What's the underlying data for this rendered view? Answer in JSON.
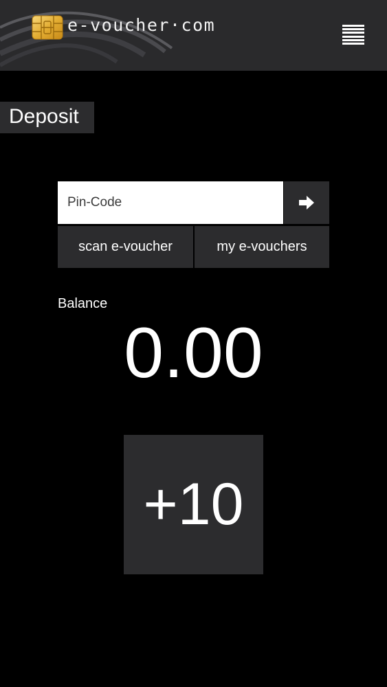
{
  "header": {
    "brand": "e-voucher·com",
    "logo_icon": "sim-chip-icon",
    "menu_icon": "hamburger-menu-icon"
  },
  "page": {
    "title": "Deposit"
  },
  "pin": {
    "placeholder": "Pin-Code",
    "value": "",
    "submit_icon": "arrow-right-icon"
  },
  "buttons": {
    "scan": "scan e-voucher",
    "my_vouchers": "my e-vouchers",
    "add_amount": "+10"
  },
  "balance": {
    "label": "Balance",
    "value": "0.00"
  },
  "colors": {
    "background": "#000000",
    "header": "#2a2a2c",
    "panel": "#2c2c2e",
    "chip": "#e8b43a",
    "text": "#ffffff"
  }
}
